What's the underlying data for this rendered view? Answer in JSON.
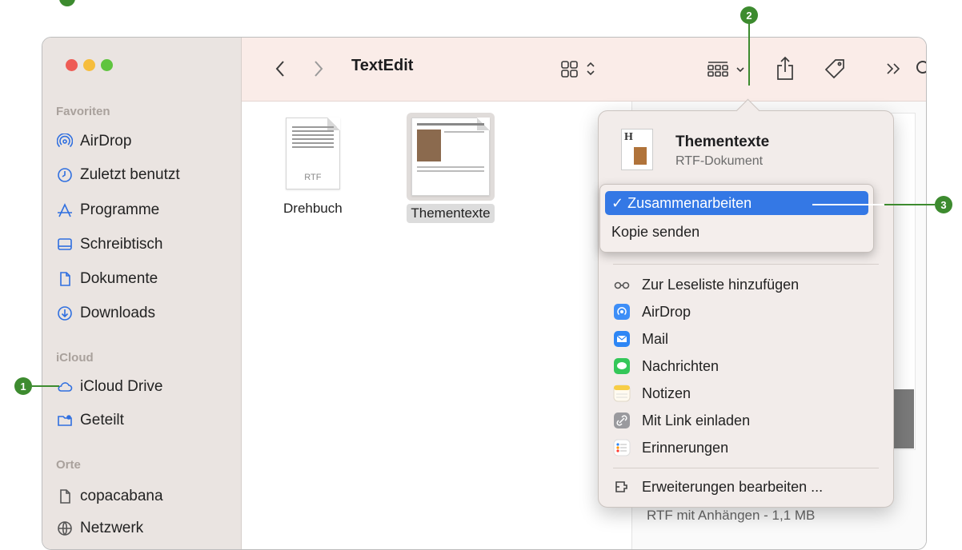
{
  "window": {
    "title": "TextEdit"
  },
  "sidebar": {
    "sections": [
      {
        "label": "Favoriten"
      },
      {
        "label": "iCloud"
      },
      {
        "label": "Orte"
      }
    ],
    "items": [
      {
        "label": "AirDrop",
        "icon": "airdrop-icon"
      },
      {
        "label": "Zuletzt benutzt",
        "icon": "clock-icon"
      },
      {
        "label": "Programme",
        "icon": "apps-icon"
      },
      {
        "label": "Schreibtisch",
        "icon": "desktop-icon"
      },
      {
        "label": "Dokumente",
        "icon": "document-icon"
      },
      {
        "label": "Downloads",
        "icon": "download-icon"
      },
      {
        "label": "iCloud Drive",
        "icon": "cloud-icon"
      },
      {
        "label": "Geteilt",
        "icon": "shared-folder-icon"
      },
      {
        "label": "copacabana",
        "icon": "document-icon"
      },
      {
        "label": "Netzwerk",
        "icon": "globe-icon"
      }
    ]
  },
  "files": [
    {
      "name": "Drehbuch",
      "type_label": "RTF"
    },
    {
      "name": "Thementexte"
    }
  ],
  "preview": {
    "info": "RTF mit Anhängen - 1,1 MB"
  },
  "share_menu": {
    "doc_title": "Thementexte",
    "doc_type": "RTF-Dokument",
    "submenu": [
      {
        "label": "✓ Zusammenarbeiten",
        "selected": true
      },
      {
        "label": "Kopie senden"
      }
    ],
    "items": [
      {
        "label": "Zur Leseliste hinzufügen",
        "icon": "reading-list-icon"
      },
      {
        "label": "AirDrop",
        "icon": "airdrop-icon"
      },
      {
        "label": "Mail",
        "icon": "mail-icon"
      },
      {
        "label": "Nachrichten",
        "icon": "messages-icon"
      },
      {
        "label": "Notizen",
        "icon": "notes-icon"
      },
      {
        "label": "Mit Link einladen",
        "icon": "link-icon"
      },
      {
        "label": "Erinnerungen",
        "icon": "reminders-icon"
      }
    ],
    "footer_item": {
      "label": "Erweiterungen bearbeiten ...",
      "icon": "extensions-icon"
    }
  },
  "annotations": [
    {
      "label": "1"
    },
    {
      "label": "2"
    },
    {
      "label": "3"
    }
  ],
  "colors": {
    "accent": "#3478e5",
    "callout": "#3d8b2f",
    "sidebar": "#eae4e1",
    "toolbar": "#faece8"
  }
}
